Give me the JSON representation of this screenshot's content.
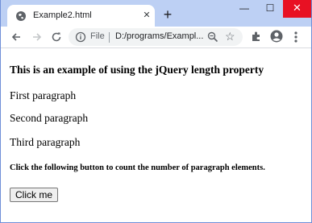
{
  "browser": {
    "tab_title": "Example2.html",
    "new_tab_symbol": "+",
    "address_scheme_label": "File",
    "address_url": "D:/programs/Exampl...",
    "window_controls": {
      "minimize": "—",
      "maximize": "☐",
      "close": "✕"
    },
    "icons": [
      "globe-icon",
      "back-arrow-icon",
      "forward-arrow-icon",
      "reload-icon",
      "info-icon",
      "zoom-icon",
      "star-icon",
      "extensions-icon",
      "profile-icon",
      "menu-icon"
    ]
  },
  "page": {
    "heading": "This is an example of using the jQuery length property",
    "paragraphs": [
      "First paragraph",
      "Second paragraph",
      "Third paragraph"
    ],
    "instruction": "Click the following button to count the number of paragraph elements.",
    "button_label": "Click me"
  }
}
